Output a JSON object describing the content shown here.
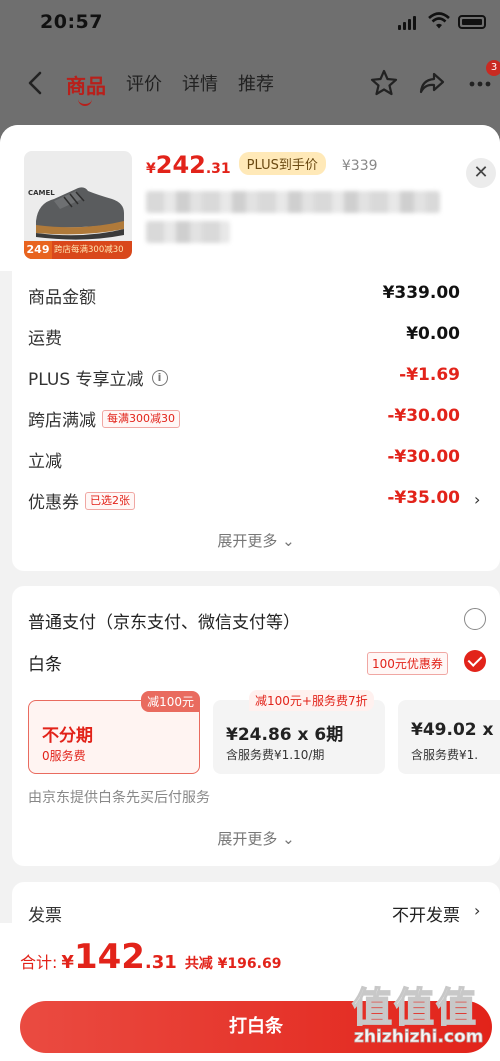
{
  "status_bar": {
    "time": "20:57"
  },
  "nav": {
    "tabs": [
      "商品",
      "评价",
      "详情",
      "推荐"
    ],
    "cart_badge": "3",
    "icons": [
      "back-icon",
      "star-icon",
      "share-icon",
      "more-icon"
    ]
  },
  "product": {
    "brand": "CAMEL",
    "thumb_price": "249",
    "thumb_promo": "跨店每满300减30",
    "price_currency": "¥",
    "price_int": "242",
    "price_dec": ".31",
    "plus_tag": "PLUS到手价",
    "original_price": "¥339"
  },
  "amounts": {
    "rows": [
      {
        "label": "商品金额",
        "value": "¥339.00"
      },
      {
        "label": "运费",
        "value": "¥0.00"
      },
      {
        "label": "PLUS 专享立减",
        "value": "-¥1.69"
      },
      {
        "label": "跨店满减",
        "tag": "每满300减30",
        "value": "-¥30.00"
      },
      {
        "label": "立减",
        "value": "-¥30.00"
      },
      {
        "label": "优惠券",
        "tag": "已选2张",
        "value": "-¥35.00"
      }
    ],
    "expand": "展开更多"
  },
  "payment": {
    "normal_label": "普通支付（京东支付、微信支付等）",
    "baitiao_label": "白条",
    "baitiao_coupon": "100元优惠券",
    "plans": [
      {
        "badge": "减100元",
        "title": "不分期",
        "sub": "0服务费"
      },
      {
        "badge": "减100元+服务费7折",
        "title": "¥24.86 x 6期",
        "sub": "含服务费¥1.10/期"
      },
      {
        "title": "¥49.02 x",
        "sub": "含服务费¥1."
      }
    ],
    "note": "由京东提供白条先买后付服务",
    "expand": "展开更多"
  },
  "invoice": {
    "label": "发票",
    "value": "不开发票"
  },
  "footer": {
    "total_label": "合计:",
    "total_currency": "¥",
    "total_int": "142",
    "total_dec": ".31",
    "total_saving": "共减 ¥196.69",
    "pay_button": "打白条"
  },
  "watermark": {
    "chars": "值值值",
    "url": "zhizhizhi.com"
  },
  "colors": {
    "accent": "#e2231a",
    "plus_bg": "#ffe9b8",
    "sheet_bg": "#f2f2f2"
  }
}
